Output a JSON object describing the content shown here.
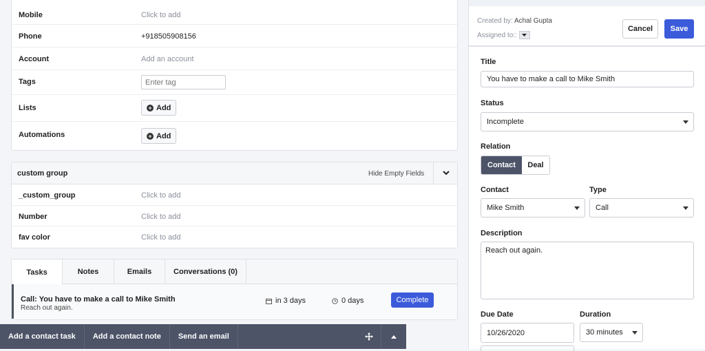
{
  "contact_fields": [
    {
      "label": "Mobile",
      "value": "Click to add"
    },
    {
      "label": "Phone",
      "value": "+918505908156"
    },
    {
      "label": "Account",
      "value": "Add an account"
    },
    {
      "label": "Tags",
      "placeholder": "Enter tag"
    },
    {
      "label": "Lists",
      "button": "Add"
    },
    {
      "label": "Automations",
      "button": "Add"
    }
  ],
  "custom_group": {
    "title": "custom group",
    "hide_empty": "Hide Empty Fields",
    "fields": [
      {
        "label": "_custom_group",
        "value": "Click to add"
      },
      {
        "label": "Number",
        "value": "Click to add"
      },
      {
        "label": "fav color",
        "value": "Click to add"
      }
    ]
  },
  "activity": {
    "tabs": [
      "Tasks",
      "Notes",
      "Emails",
      "Conversations (0)"
    ],
    "task": {
      "title": "Call: You have to make a call to Mike Smith",
      "subtitle": "Reach out again.",
      "due": "in 3 days",
      "duration": "0 days",
      "complete_label": "Complete"
    }
  },
  "bottom_bar": {
    "items": [
      "Add a contact task",
      "Add a contact note",
      "Send an email"
    ]
  },
  "task_panel": {
    "created_by_label": "Created by:",
    "created_by": "Achal Gupta",
    "assigned_to_label": "Assigned to::",
    "cancel_label": "Cancel",
    "save_label": "Save",
    "title_label": "Title",
    "title_value": "You have to make a call to Mike Smith",
    "status_label": "Status",
    "status_value": "Incomplete",
    "relation_label": "Relation",
    "relation_options": [
      "Contact",
      "Deal"
    ],
    "contact_label": "Contact",
    "contact_value": "Mike Smith",
    "type_label": "Type",
    "type_value": "Call",
    "description_label": "Description",
    "description_value": "Reach out again.",
    "due_date_label": "Due Date",
    "due_date_value": "10/26/2020",
    "duration_label": "Duration",
    "duration_value": "30 minutes"
  },
  "colors": {
    "primary": "#3b5bdb",
    "bar": "#4d5468",
    "active_toggle": "#4d5468"
  }
}
